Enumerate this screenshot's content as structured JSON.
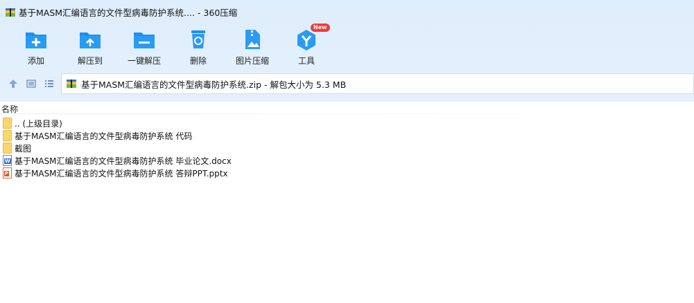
{
  "window": {
    "title": "基于MASM汇编语言的文件型病毒防护系统.... - 360压缩"
  },
  "toolbar": {
    "buttons": [
      {
        "label": "添加",
        "icon": "add-icon"
      },
      {
        "label": "解压到",
        "icon": "extract-to-icon"
      },
      {
        "label": "一键解压",
        "icon": "one-click-extract-icon"
      },
      {
        "label": "删除",
        "icon": "delete-icon"
      },
      {
        "label": "图片压缩",
        "icon": "image-compress-icon"
      },
      {
        "label": "工具",
        "icon": "tools-icon",
        "badge": "New"
      }
    ]
  },
  "navbar": {
    "path": "基于MASM汇编语言的文件型病毒防护系统.zip - 解包大小为 5.3 MB"
  },
  "list": {
    "columns": {
      "name": "名称"
    },
    "items": [
      {
        "name": ".. (上级目录)",
        "type": "folder"
      },
      {
        "name": "基于MASM汇编语言的文件型病毒防护系统 代码",
        "type": "folder"
      },
      {
        "name": "截图",
        "type": "folder"
      },
      {
        "name": "基于MASM汇编语言的文件型病毒防护系统 毕业论文.docx",
        "type": "docx"
      },
      {
        "name": "基于MASM汇编语言的文件型病毒防护系统 答辩PPT.pptx",
        "type": "pptx"
      }
    ]
  },
  "colors": {
    "chrome_bg": "#e1effc",
    "icon_blue": "#1e8ef0",
    "badge_red": "#ef3a3a"
  }
}
